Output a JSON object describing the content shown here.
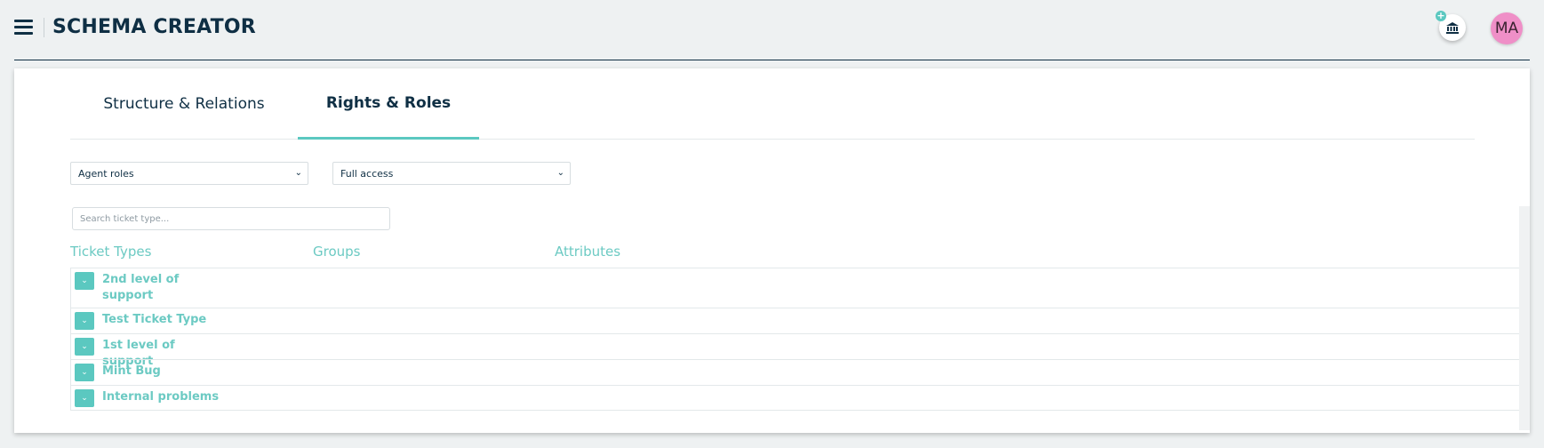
{
  "header": {
    "title": "SCHEMA CREATOR",
    "add_badge": "+",
    "avatar_initials": "MA"
  },
  "tabs": [
    {
      "label": "Structure & Relations"
    },
    {
      "label": "Rights & Roles"
    }
  ],
  "filters": {
    "role_select": "Agent roles",
    "access_select": "Full access"
  },
  "search": {
    "placeholder": "Search ticket type..."
  },
  "columns": [
    "Ticket Types",
    "Groups",
    "Attributes"
  ],
  "ticket_types": [
    {
      "label": "2nd level of support"
    },
    {
      "label": "Test Ticket Type"
    },
    {
      "label": "1st level of support"
    },
    {
      "label": "Mint Bug"
    },
    {
      "label": "Internal problems"
    }
  ],
  "colors": {
    "accent": "#5bc8c0",
    "text_dark": "#0f2f44",
    "avatar_bg": "#ef8fc7"
  },
  "icons": [
    "menu-icon",
    "bank-icon",
    "chevron-down-icon"
  ]
}
